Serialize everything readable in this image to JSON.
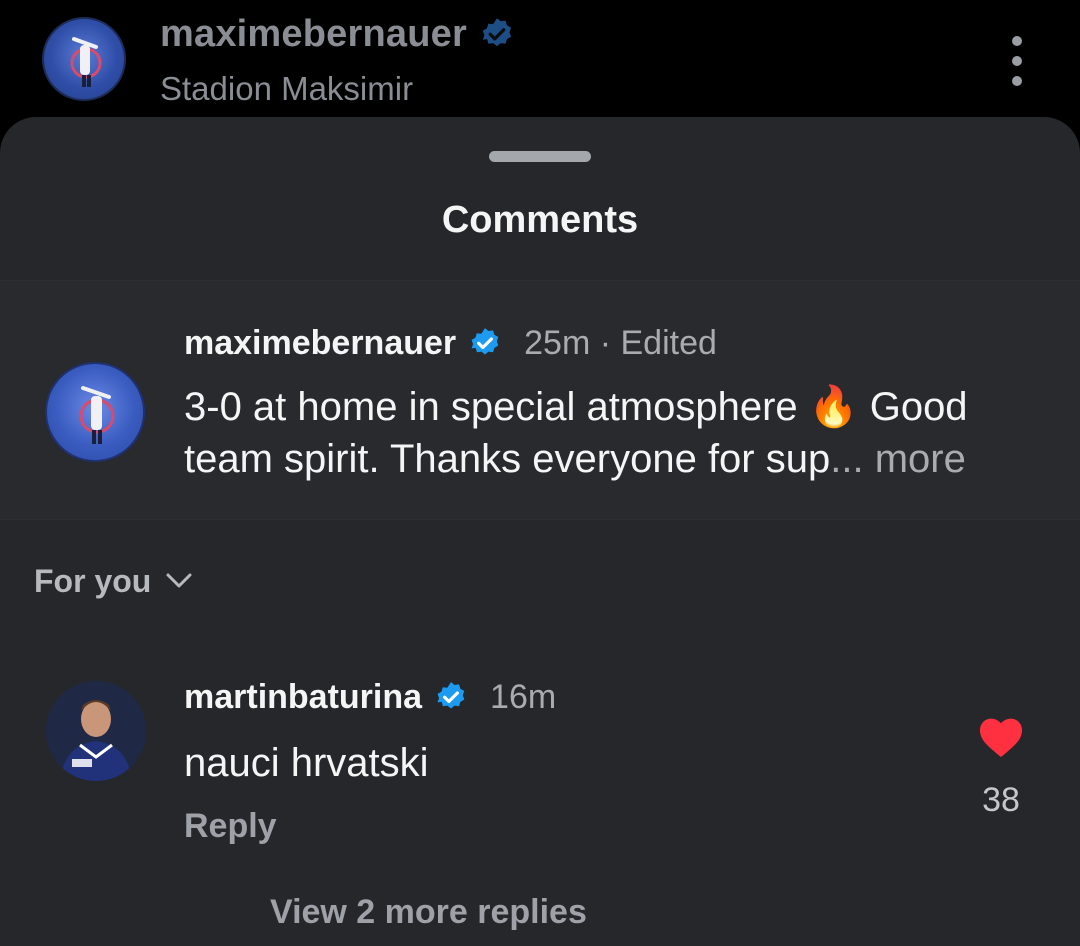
{
  "post_header": {
    "username": "maximebernauer",
    "location": "Stadion Maksimir",
    "avatar_icon": "jersey-avatar-icon",
    "verified_icon": "verified-badge-icon",
    "more_icon": "more-vertical-icon"
  },
  "sheet": {
    "title": "Comments",
    "handle_icon": "drag-handle-icon"
  },
  "caption": {
    "username": "maximebernauer",
    "time": "25m · Edited",
    "text": "3-0 at home in special atmosphere 🔥 Good team spirit. Thanks everyone for sup",
    "ellipsis": "...",
    "more_label": " more"
  },
  "sort": {
    "label": "For you",
    "icon": "chevron-down-icon"
  },
  "comment": {
    "username": "martinbaturina",
    "time": "16m",
    "text": "nauci hrvatski",
    "reply_label": "Reply",
    "like_count": "38",
    "like_icon": "heart-filled-icon",
    "liked": true
  },
  "view_replies_label": "View 2 more replies",
  "colors": {
    "verified_blue": "#1d9bf0",
    "heart_red": "#ff3040",
    "sheet_bg": "#25272b",
    "muted_text": "#a8abb0"
  }
}
